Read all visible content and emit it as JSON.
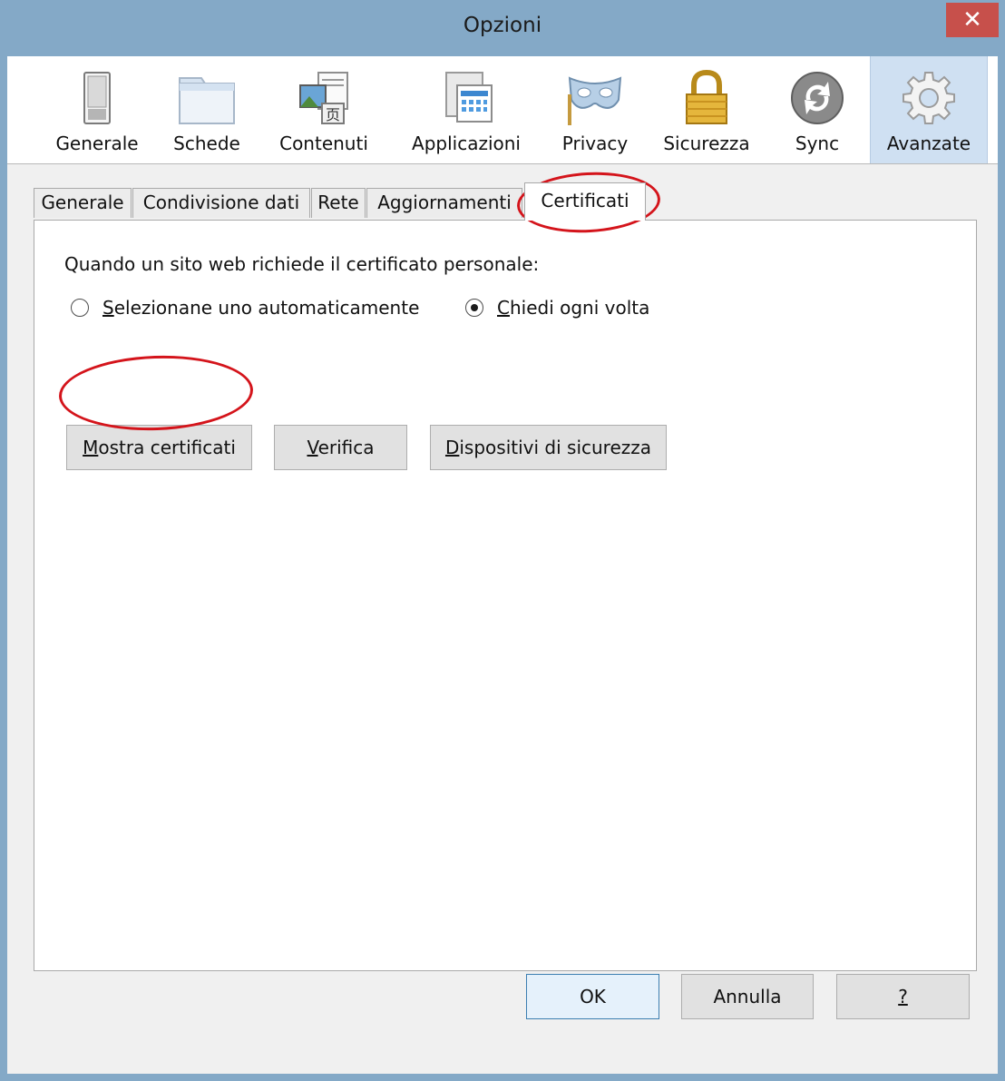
{
  "window": {
    "title": "Opzioni",
    "close_glyph": "✕"
  },
  "toolbar": {
    "panes": [
      {
        "label": "Generale",
        "icon": "toggle-switch-icon",
        "selected": false
      },
      {
        "label": "Schede",
        "icon": "folder-tabs-icon",
        "selected": false
      },
      {
        "label": "Contenuti",
        "icon": "content-page-icon",
        "selected": false
      },
      {
        "label": "Applicazioni",
        "icon": "applications-calendar-icon",
        "selected": false
      },
      {
        "label": "Privacy",
        "icon": "privacy-mask-icon",
        "selected": false
      },
      {
        "label": "Sicurezza",
        "icon": "padlock-icon",
        "selected": false
      },
      {
        "label": "Sync",
        "icon": "sync-icon",
        "selected": false
      },
      {
        "label": "Avanzate",
        "icon": "gear-icon",
        "selected": true
      }
    ]
  },
  "tabs": [
    {
      "label": "Generale",
      "active": false
    },
    {
      "label": "Condivisione dati",
      "active": false
    },
    {
      "label": "Rete",
      "active": false
    },
    {
      "label": "Aggiornamenti",
      "active": false
    },
    {
      "label": "Certificati",
      "active": true
    }
  ],
  "certificates": {
    "heading": "Quando un sito web richiede il certificato personale:",
    "radio_auto": {
      "label": "Selezionane uno automaticamente",
      "accesskey": "S",
      "checked": false
    },
    "radio_ask": {
      "label": "Chiedi ogni volta",
      "accesskey": "C",
      "checked": true
    },
    "buttons": {
      "show": {
        "label": "Mostra certificati",
        "accesskey": "M"
      },
      "verify": {
        "label": "Verifica",
        "accesskey": "V"
      },
      "devices": {
        "label": "Dispositivi di sicurezza",
        "accesskey": "D"
      }
    }
  },
  "footer": {
    "ok": "OK",
    "cancel": "Annulla",
    "help": "?"
  },
  "annotation_color": "#d4141b"
}
